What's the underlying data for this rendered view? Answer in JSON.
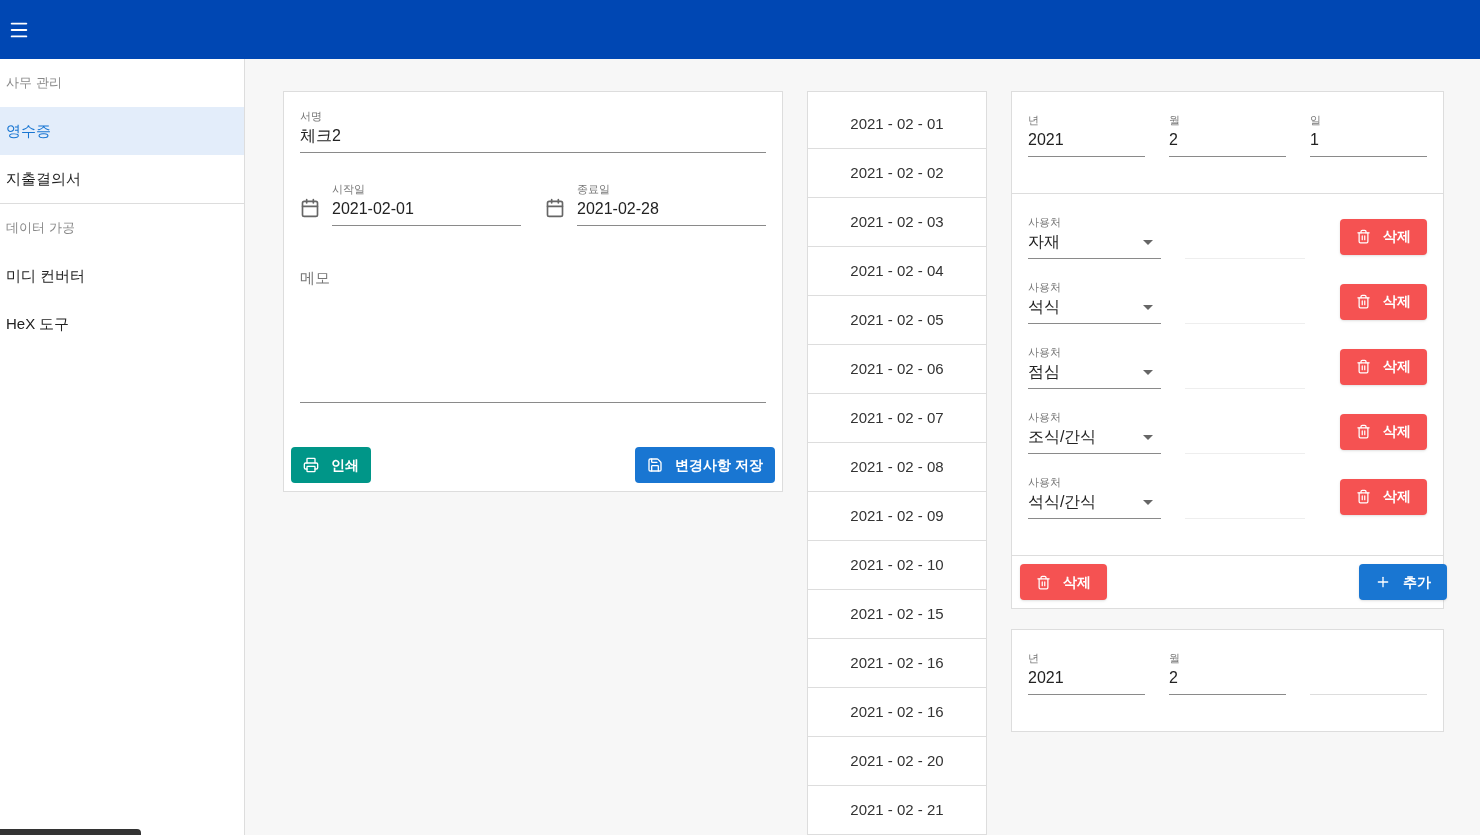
{
  "sidebar": {
    "sections": [
      {
        "header": "사무 관리",
        "items": [
          {
            "label": "영수증",
            "selected": true
          },
          {
            "label": "지출결의서",
            "selected": false
          }
        ]
      },
      {
        "header": "데이터 가공",
        "items": [
          {
            "label": "미디 컨버터",
            "selected": false
          },
          {
            "label": "HeX 도구",
            "selected": false
          }
        ]
      }
    ]
  },
  "form": {
    "name_label": "서명",
    "name": "체크2",
    "start_label": "시작일",
    "start": "2021-02-01",
    "end_label": "종료일",
    "end": "2021-02-28",
    "memo_placeholder": "메모",
    "print": "인쇄",
    "save": "변경사항 저장"
  },
  "dates": [
    "2021 - 02 - 01",
    "2021 - 02 - 02",
    "2021 - 02 - 03",
    "2021 - 02 - 04",
    "2021 - 02 - 05",
    "2021 - 02 - 06",
    "2021 - 02 - 07",
    "2021 - 02 - 08",
    "2021 - 02 - 09",
    "2021 - 02 - 10",
    "2021 - 02 - 15",
    "2021 - 02 - 16",
    "2021 - 02 - 16",
    "2021 - 02 - 20",
    "2021 - 02 - 21"
  ],
  "entries": [
    {
      "year_label": "년",
      "year": "2021",
      "month_label": "월",
      "month": "2",
      "day_label": "일",
      "day": "1",
      "items": [
        {
          "label": "사용처",
          "value": "자재",
          "delete": "삭제"
        },
        {
          "label": "사용처",
          "value": "석식",
          "delete": "삭제"
        },
        {
          "label": "사용처",
          "value": "점심",
          "delete": "삭제"
        },
        {
          "label": "사용처",
          "value": "조식/간식",
          "delete": "삭제"
        },
        {
          "label": "사용처",
          "value": "석식/간식",
          "delete": "삭제"
        }
      ],
      "delete": "삭제",
      "add": "추가"
    },
    {
      "year_label": "년",
      "year": "2021",
      "month_label": "월",
      "month": "2"
    }
  ]
}
